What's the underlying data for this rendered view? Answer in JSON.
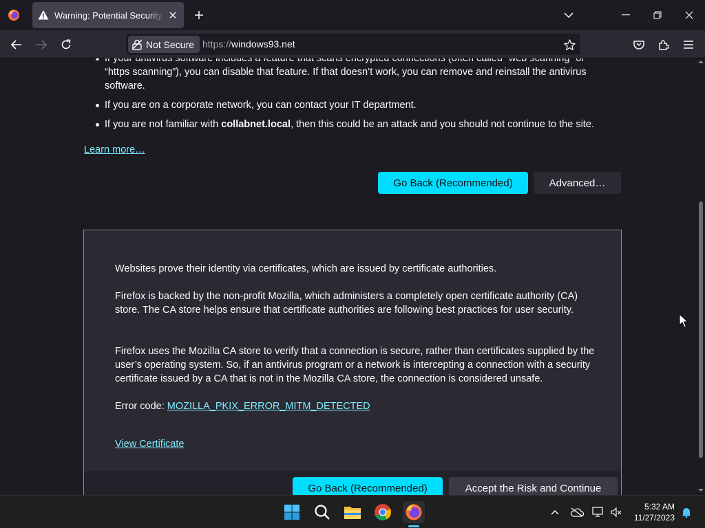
{
  "browser": {
    "tab_title": "Warning: Potential Security Risk Ahead",
    "url_scheme": "https://",
    "url_host": "windows93.net",
    "not_secure_label": "Not Secure"
  },
  "page": {
    "bullets": [
      "If your antivirus software includes a feature that scans encrypted connections (often called “web scanning” or “https scanning”), you can disable that feature. If that doesn’t work, you can remove and reinstall the antivirus software.",
      "If you are on a corporate network, you can contact your IT department."
    ],
    "bullet3_prefix": "If you are not familiar with ",
    "bullet3_host": "collabnet.local",
    "bullet3_suffix": ", then this could be an attack and you should not continue to the site.",
    "learn_more": "Learn more…",
    "go_back": "Go Back (Recommended)",
    "advanced": "Advanced…",
    "panel": {
      "p1": "Websites prove their identity via certificates, which are issued by certificate authorities.",
      "p2": "Firefox is backed by the non-profit Mozilla, which administers a completely open certificate authority (CA) store. The CA store helps ensure that certificate authorities are following best practices for user security.",
      "p3": "Firefox uses the Mozilla CA store to verify that a connection is secure, rather than certificates supplied by the user’s operating system. So, if an antivirus program or a network is intercepting a connection with a security certificate issued by a CA that is not in the Mozilla CA store, the connection is considered unsafe.",
      "error_code_label": "Error code: ",
      "error_code": "MOZILLA_PKIX_ERROR_MITM_DETECTED",
      "view_certificate": "View Certificate",
      "go_back": "Go Back (Recommended)",
      "accept_risk": "Accept the Risk and Continue"
    }
  },
  "taskbar": {
    "time": "5:32 AM",
    "date": "11/27/2023",
    "apps": [
      "start-icon",
      "search-icon",
      "file-explorer-icon",
      "chrome-icon",
      "firefox-icon"
    ]
  },
  "colors": {
    "accent": "#00ddff",
    "link": "#80ebff",
    "background": "#1c1b22",
    "panel": "#2b2a33"
  }
}
